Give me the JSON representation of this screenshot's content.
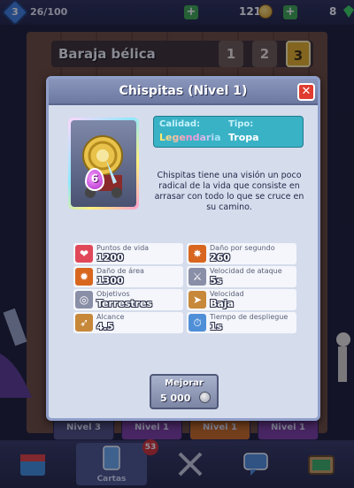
{
  "top_bar": {
    "level": "3",
    "xp": "26/100",
    "gold": "121",
    "gems": "8"
  },
  "deck": {
    "title": "Baraja bélica",
    "tabs": [
      "1",
      "2",
      "3"
    ],
    "active_tab": "3"
  },
  "bottom_cards": [
    "Nivel 3",
    "Nivel 1",
    "Nivel 1",
    "Nivel 1"
  ],
  "nav": {
    "cards_label": "Cartas",
    "cards_badge": "53"
  },
  "modal": {
    "title": "Chispitas (Nivel 1)",
    "close": "✕",
    "elixir_cost": "6",
    "quality_label": "Calidad:",
    "quality_value": "Legendaria",
    "type_label": "Tipo:",
    "type_value": "Tropa",
    "description": "Chispitas tiene una visión un poco radical de la vida que consiste en arrasar con todo lo que se cruce en su camino.",
    "stats": [
      {
        "label": "Puntos de vida",
        "value": "1200",
        "icon": "heart-icon",
        "color": "#e0485a"
      },
      {
        "label": "Daño por segundo",
        "value": "260",
        "icon": "explosion-icon",
        "color": "#d8661f"
      },
      {
        "label": "Daño de área",
        "value": "1300",
        "icon": "area-damage-icon",
        "color": "#d8661f"
      },
      {
        "label": "Velocidad de ataque",
        "value": "5s",
        "icon": "sword-icon",
        "color": "#8a8fa8"
      },
      {
        "label": "Objetivos",
        "value": "Terrestres",
        "icon": "target-icon",
        "color": "#8a8fa8"
      },
      {
        "label": "Velocidad",
        "value": "Baja",
        "icon": "boot-icon",
        "color": "#c7883a"
      },
      {
        "label": "Alcance",
        "value": "4.5",
        "icon": "bow-icon",
        "color": "#c7883a"
      },
      {
        "label": "Tiempo de despliegue",
        "value": "1s",
        "icon": "clock-icon",
        "color": "#4f8fd8"
      }
    ],
    "upgrade_label": "Mejorar",
    "upgrade_cost": "5 000"
  }
}
